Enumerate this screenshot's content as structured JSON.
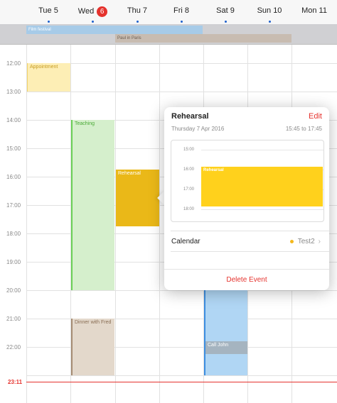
{
  "header": {
    "days": [
      {
        "label": "Tue 5"
      },
      {
        "label": "Wed",
        "badge": "6"
      },
      {
        "label": "Thu 7"
      },
      {
        "label": "Fri 8"
      },
      {
        "label": "Sat 9"
      },
      {
        "label": "Sun 10"
      },
      {
        "label": "Mon 11"
      }
    ]
  },
  "allday": {
    "film_festival": "Film festival",
    "paul_in_paris": "Paul in Paris"
  },
  "hours": [
    "12:00",
    "13:00",
    "14:00",
    "15:00",
    "16:00",
    "17:00",
    "18:00",
    "19:00",
    "20:00",
    "21:00",
    "22:00"
  ],
  "events": {
    "appointment": "Appointment",
    "teaching": "Teaching",
    "rehearsal": "Rehearsal",
    "dinner": "Dinner with Fred",
    "call": "Call John"
  },
  "now_label": "23:11",
  "popover": {
    "title": "Rehearsal",
    "edit": "Edit",
    "date": "Thursday 7 Apr 2016",
    "time": "15:45 to 17:45",
    "mini_hours": [
      "15:00",
      "16:00",
      "17:00",
      "18:00"
    ],
    "mini_event": "Rehearsal",
    "calendar_label": "Calendar",
    "calendar_value": "Test2",
    "delete": "Delete Event"
  },
  "colors": {
    "today": "#e5322d",
    "film_festival": "#a7cbe8",
    "paul_in_paris": "#c8bcb1",
    "appointment": "#fdeeb5",
    "teaching": "#d5efcc",
    "rehearsal": "#eab818",
    "dinner": "#e3d8cb",
    "call": "#b0d6f4"
  }
}
